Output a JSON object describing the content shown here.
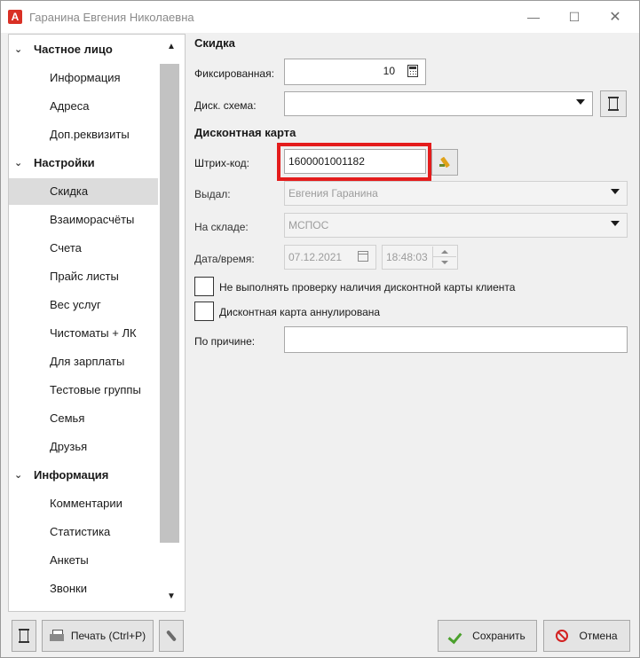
{
  "window": {
    "logo_letter": "A",
    "title": "Гаранина Евгения Николаевна",
    "minimize_glyph": "—",
    "maximize_glyph": "☐",
    "close_glyph": "✕"
  },
  "sidebar": {
    "groups": [
      {
        "label": "Частное лицо",
        "items": [
          "Информация",
          "Адреса",
          "Доп.реквизиты"
        ]
      },
      {
        "label": "Настройки",
        "items": [
          "Скидка",
          "Взаиморасчёты",
          "Счета",
          "Прайс листы",
          "Вес услуг",
          "Чистоматы + ЛК",
          "Для зарплаты",
          "Тестовые группы",
          "Семья",
          "Друзья"
        ]
      },
      {
        "label": "Информация",
        "items": [
          "Комментарии",
          "Статистика",
          "Анкеты",
          "Звонки"
        ]
      }
    ],
    "selected_item": "Скидка"
  },
  "discount": {
    "section_title": "Скидка",
    "fixed_label": "Фиксированная:",
    "fixed_value": "10",
    "scheme_label": "Диск. схема:",
    "scheme_value": ""
  },
  "card": {
    "section_title": "Дисконтная карта",
    "barcode_label": "Штрих-код:",
    "barcode_value": "1600001001182",
    "issued_by_label": "Выдал:",
    "issued_by_value": "Евгения Гаранина",
    "warehouse_label": "На складе:",
    "warehouse_value": "МСПОС",
    "datetime_label": "Дата/время:",
    "date_value": "07.12.2021",
    "time_value": "18:48:03",
    "checkbox_skip_check": "Не выполнять проверку наличия дисконтной карты клиента",
    "checkbox_cancelled": "Дисконтная карта аннулирована",
    "reason_label": "По причине:",
    "reason_value": ""
  },
  "footer": {
    "print_label": "Печать (Ctrl+P)",
    "save_label": "Сохранить",
    "cancel_label": "Отмена"
  },
  "colors": {
    "highlight": "#e41c1c",
    "save_check": "#4aa02c",
    "cancel_icon": "#d32020",
    "logo": "#d93025"
  }
}
